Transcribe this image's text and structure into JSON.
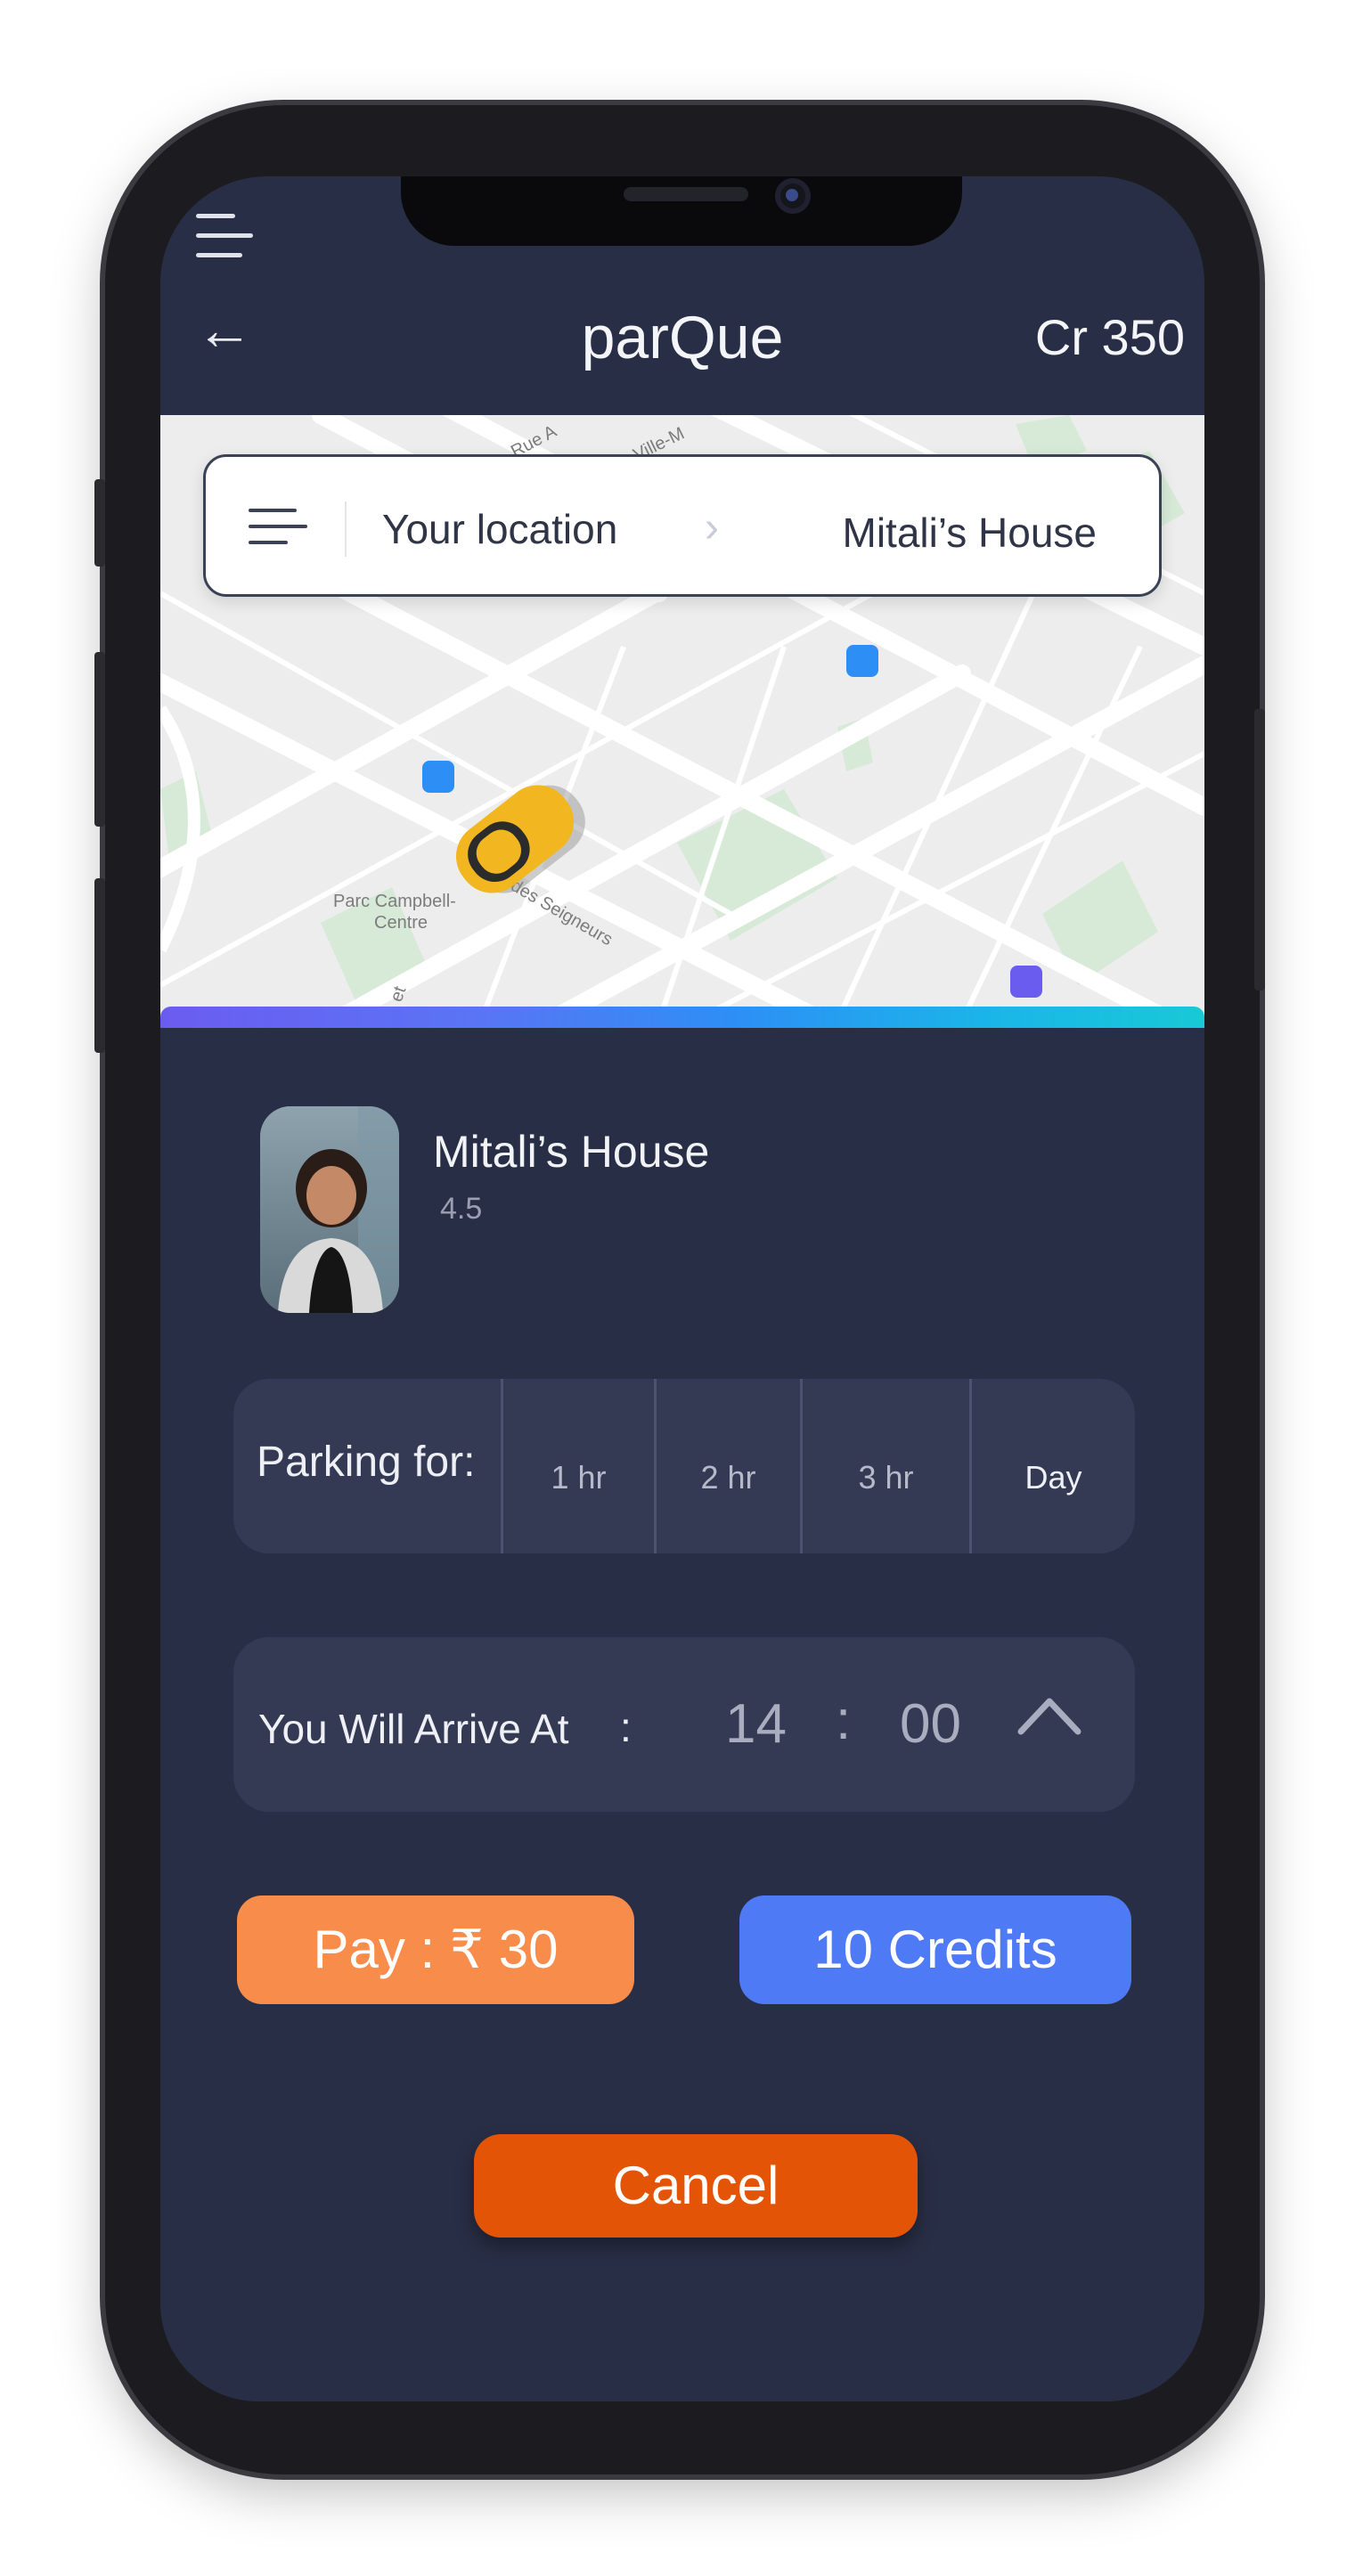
{
  "app": {
    "title": "parQue",
    "credits_balance": "Cr 350"
  },
  "header": {
    "back_icon": "arrow-left-icon",
    "menu_icon": "hamburger-menu-icon"
  },
  "route": {
    "from": "Your location",
    "to": "Mitali’s House",
    "separator_icon": "chevron-right-icon"
  },
  "map": {
    "labels": [
      "Rue A",
      "Autoroute Ville-M",
      "Parc Campbell-",
      "Centre",
      "des Seigneurs",
      "et"
    ],
    "marker_colors": [
      "#2d8ff5",
      "#2d8ff5",
      "#6b5cf0"
    ],
    "vehicle_icon": "taxi-car-icon"
  },
  "progress": {
    "colors": [
      "#6b5cf0",
      "#2d8ff5",
      "#18c9d6"
    ]
  },
  "host": {
    "name": "Mitali’s House",
    "rating": "4.5",
    "photo_icon": "host-avatar"
  },
  "parking": {
    "label": "Parking for:",
    "options": [
      "1 hr",
      "2 hr",
      "3 hr",
      "Day"
    ]
  },
  "arrival": {
    "label": "You Will Arrive At",
    "colon": ":",
    "hours": "14",
    "separator": ":",
    "minutes": "00",
    "toggle_icon": "chevron-up-icon"
  },
  "actions": {
    "pay_label": "Pay : ₹ 30",
    "credits_label": "10 Credits",
    "cancel_label": "Cancel"
  },
  "colors": {
    "background": "#282e45",
    "panel": "#343a53",
    "pay": "#f88c4a",
    "credits": "#4f7af5",
    "cancel": "#e35406"
  }
}
